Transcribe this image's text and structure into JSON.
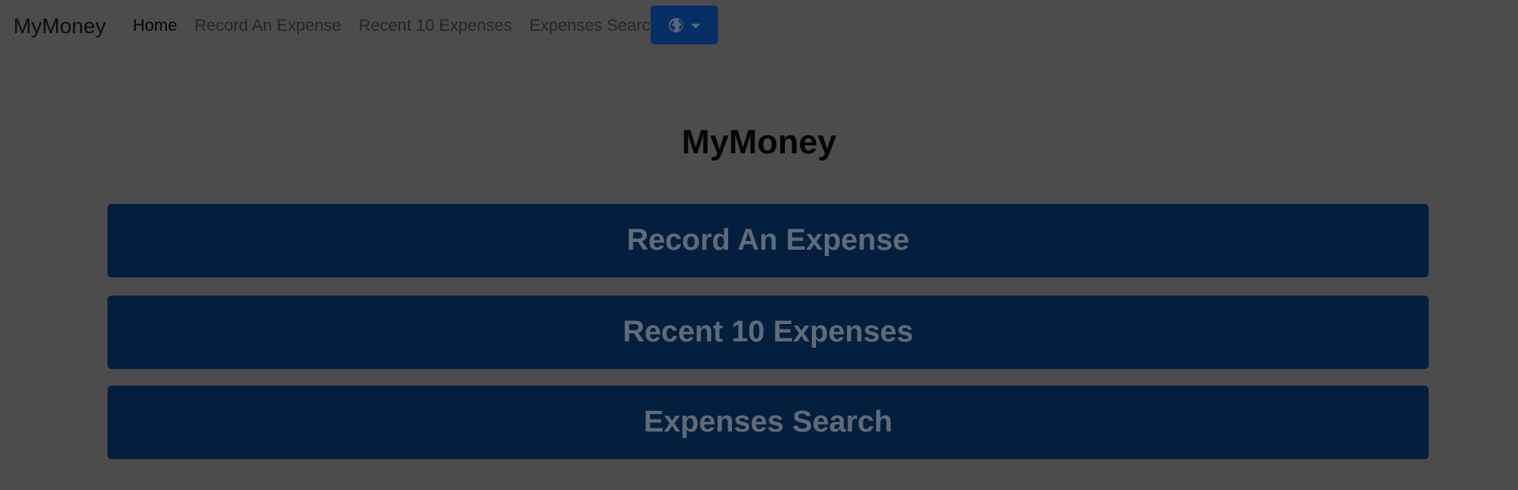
{
  "navbar": {
    "brand": "MyMoney",
    "links": [
      {
        "label": "Home",
        "active": true
      },
      {
        "label": "Record An Expense",
        "active": false
      },
      {
        "label": "Recent 10 Expenses",
        "active": false
      },
      {
        "label": "Expenses Search",
        "active": false
      }
    ],
    "language_button": {
      "icon": "globe-icon",
      "dropdown_icon": "caret-down-icon"
    }
  },
  "main": {
    "title": "MyMoney",
    "buttons": [
      {
        "label": "Record An Expense"
      },
      {
        "label": "Recent 10 Expenses"
      },
      {
        "label": "Expenses Search"
      }
    ]
  },
  "colors": {
    "background": "#4c4c4c",
    "primary_button": "#041f3d",
    "primary_button_text": "#5f6b79",
    "nav_button": "#062f66"
  }
}
